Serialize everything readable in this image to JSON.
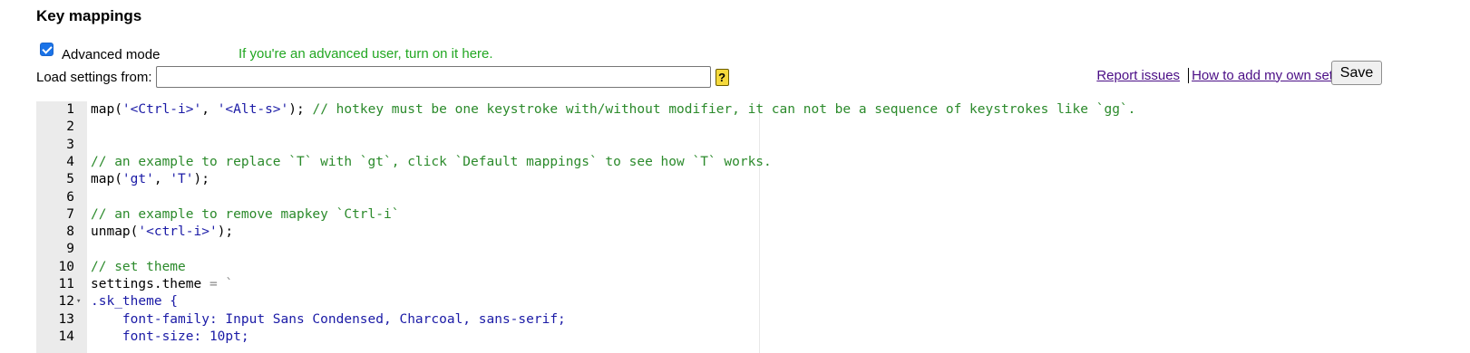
{
  "header": {
    "title": "Key mappings"
  },
  "advanced": {
    "checked": true,
    "label": "Advanced mode",
    "hint": "If you're an advanced user, turn on it here."
  },
  "load": {
    "label": "Load settings from:",
    "value": "",
    "help": "?"
  },
  "links": {
    "report": "Report issues",
    "howto": "How to add my own settings?",
    "save": "Save"
  },
  "colors": {
    "hint": "#22a722",
    "link": "#4b0e86",
    "string": "#1a1aa6",
    "comment": "#2b8a2b",
    "checkbox": "#1a73e8"
  },
  "editor": {
    "lines": [
      {
        "n": "1",
        "fold": false,
        "tokens": [
          [
            "t",
            "map("
          ],
          [
            "s",
            "'<Ctrl-i>'"
          ],
          [
            "t",
            ", "
          ],
          [
            "s",
            "'<Alt-s>'"
          ],
          [
            "t",
            "); "
          ],
          [
            "c",
            "// hotkey must be one keystroke with/without modifier, it can not be a sequence of keystrokes like `gg`."
          ]
        ]
      },
      {
        "n": "2",
        "fold": false,
        "tokens": []
      },
      {
        "n": "3",
        "fold": false,
        "tokens": []
      },
      {
        "n": "4",
        "fold": false,
        "tokens": [
          [
            "c",
            "// an example to replace `T` with `gt`, click `Default mappings` to see how `T` works."
          ]
        ]
      },
      {
        "n": "5",
        "fold": false,
        "tokens": [
          [
            "t",
            "map("
          ],
          [
            "s",
            "'gt'"
          ],
          [
            "t",
            ", "
          ],
          [
            "s",
            "'T'"
          ],
          [
            "t",
            ");"
          ]
        ]
      },
      {
        "n": "6",
        "fold": false,
        "tokens": []
      },
      {
        "n": "7",
        "fold": false,
        "tokens": [
          [
            "c",
            "// an example to remove mapkey `Ctrl-i`"
          ]
        ]
      },
      {
        "n": "8",
        "fold": false,
        "tokens": [
          [
            "t",
            "unmap("
          ],
          [
            "s",
            "'<ctrl-i>'"
          ],
          [
            "t",
            ");"
          ]
        ]
      },
      {
        "n": "9",
        "fold": false,
        "tokens": []
      },
      {
        "n": "10",
        "fold": false,
        "tokens": [
          [
            "c",
            "// set theme"
          ]
        ]
      },
      {
        "n": "11",
        "fold": false,
        "tokens": [
          [
            "t",
            "settings.theme "
          ],
          [
            "o",
            "="
          ],
          [
            "t",
            " "
          ],
          [
            "o",
            "`"
          ]
        ]
      },
      {
        "n": "12",
        "fold": true,
        "tokens": [
          [
            "s",
            ".sk_theme {"
          ]
        ]
      },
      {
        "n": "13",
        "fold": false,
        "tokens": [
          [
            "s",
            "    font-family: Input Sans Condensed, Charcoal, sans-serif;"
          ]
        ]
      },
      {
        "n": "14",
        "fold": false,
        "tokens": [
          [
            "s",
            "    font-size: 10pt;"
          ]
        ]
      }
    ]
  }
}
